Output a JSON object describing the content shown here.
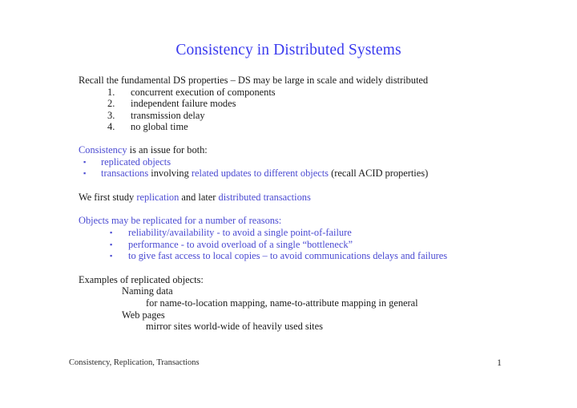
{
  "title": "Consistency in Distributed Systems",
  "colors": {
    "title_blue": "#3a3aee",
    "body_blue": "#4a4ad2",
    "body_black": "#1a1a1a"
  },
  "body": {
    "intro": "Recall the fundamental DS properties – DS may be large in scale and widely distributed",
    "numbered_list": [
      {
        "num": "1.",
        "text": "concurrent execution of components"
      },
      {
        "num": "2.",
        "text": "independent failure modes"
      },
      {
        "num": "3.",
        "text": "transmission delay"
      },
      {
        "num": "4.",
        "text": "no global time"
      }
    ],
    "consistency_heading": {
      "blue_part": "Consistency",
      "black_part": " is an issue for both:"
    },
    "consistency_bullets": [
      {
        "bullet": "▪",
        "segments": [
          {
            "text": "replicated objects",
            "color": "blue"
          }
        ]
      },
      {
        "bullet": "▪",
        "segments": [
          {
            "text": "transactions",
            "color": "blue"
          },
          {
            "text": " involving ",
            "color": "black"
          },
          {
            "text": "related updates to different objects",
            "color": "blue"
          },
          {
            "text": " (recall ACID properties)",
            "color": "black"
          }
        ]
      }
    ],
    "study_line": {
      "segments": [
        {
          "text": "We first study ",
          "color": "black"
        },
        {
          "text": "replication",
          "color": "blue"
        },
        {
          "text": " and later ",
          "color": "black"
        },
        {
          "text": "distributed transactions",
          "color": "blue"
        }
      ]
    },
    "reasons_heading": "Objects may be replicated for a number of reasons:",
    "reasons_bullets": [
      {
        "bullet": "▪",
        "text": "reliability/availability - to avoid a single point-of-failure"
      },
      {
        "bullet": "▪",
        "text": "performance - to avoid overload of a single “bottleneck”"
      },
      {
        "bullet": "▪",
        "text": "to give fast access to local copies – to avoid communications delays and failures"
      }
    ],
    "examples_heading": "Examples of replicated objects:",
    "examples": [
      {
        "indent": 1,
        "text": "Naming data"
      },
      {
        "indent": 2,
        "text": "for name-to-location mapping, name-to-attribute mapping in general"
      },
      {
        "indent": 1,
        "text": "Web pages"
      },
      {
        "indent": 2,
        "text": "mirror sites world-wide of heavily used sites"
      }
    ]
  },
  "footer": {
    "text": "Consistency, Replication, Transactions",
    "page_number": "1"
  }
}
